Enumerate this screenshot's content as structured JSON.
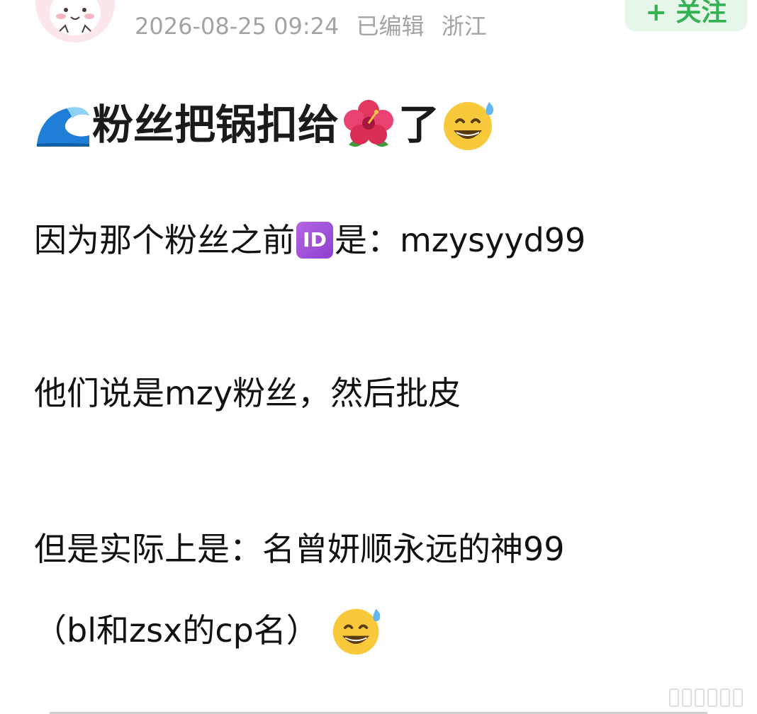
{
  "header": {
    "meta": {
      "timestamp": "2026-08-25 09:24",
      "edited": "已编辑",
      "location": "浙江"
    },
    "follow_label": "+ 关注"
  },
  "post": {
    "title_text": "粉丝把锅扣给",
    "title_suffix": "了",
    "paragraph1_prefix": "因为那个粉丝之前",
    "id_badge": "ID",
    "paragraph1_suffix": "是：mzysyyd99",
    "paragraph2": "他们说是mzy粉丝，然后批皮",
    "paragraph3": "但是实际上是：名曾妍顺永远的神99",
    "paragraph4": "（bl和zsx的cp名）"
  },
  "icons": [
    "wave-emoji",
    "hibiscus-emoji",
    "sweat-smile-emoji",
    "id-emoji"
  ],
  "colors": {
    "follow_text": "#34b150",
    "follow_bg": "#e6f6e9",
    "meta_text": "#a3a3a3"
  }
}
